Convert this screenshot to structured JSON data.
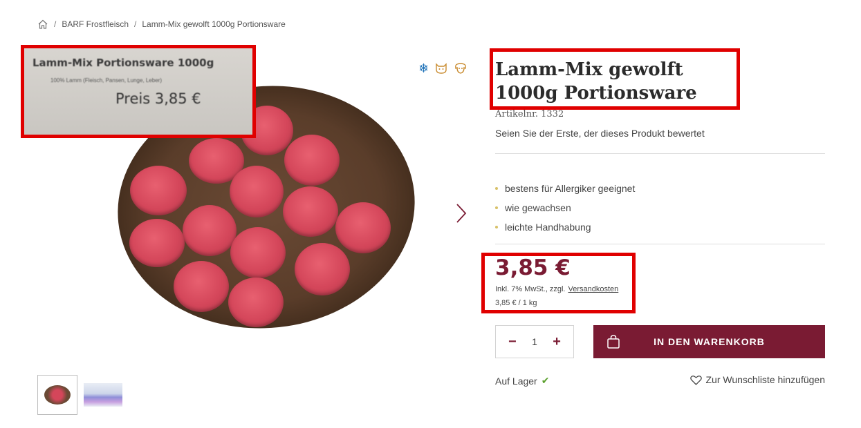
{
  "breadcrumb": {
    "items": [
      "BARF Frostfleisch",
      "Lamm-Mix gewolft 1000g Portionsware"
    ]
  },
  "gallery": {
    "label_card": {
      "title": "Lamm-Mix Portionsware 1000g",
      "subtitle": "100% Lamm (Fleisch, Pansen, Lunge, Leber)",
      "price": "Preis 3,85 €"
    },
    "feature_icons": [
      "snowflake-icon",
      "cat-icon",
      "dog-icon"
    ],
    "thumbnails": [
      "thumbnail-patties",
      "thumbnail-label"
    ]
  },
  "product": {
    "title": "Lamm-Mix gewolft 1000g Portionsware",
    "article_number": "Artikelnr. 1332",
    "rating_text": "Seien Sie der Erste, der dieses Produkt bewertet",
    "features": [
      "bestens für Allergiker geeignet",
      "wie gewachsen",
      "leichte Handhabung"
    ],
    "price": "3,85 €",
    "tax_text": "Inkl. 7% MwSt., zzgl.",
    "shipping_link": "Versandkosten",
    "unit_price": "3,85 € / 1 kg",
    "quantity": "1",
    "add_to_cart": "IN DEN WARENKORB",
    "stock": "Auf Lager",
    "wishlist": "Zur Wunschliste hinzufügen"
  },
  "colors": {
    "brand": "#7a1b33",
    "highlight_box": "#e00000",
    "in_stock": "#5aa02c",
    "bullet": "#d8c169"
  }
}
